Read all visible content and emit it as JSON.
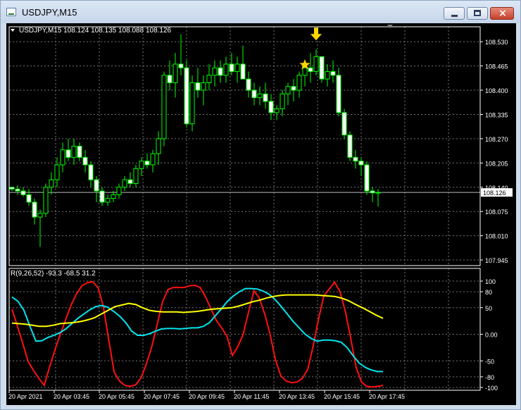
{
  "window": {
    "title": "USDJPY,M15",
    "icon": "chart-window-icon",
    "buttons": {
      "minimize": "minimize-icon",
      "maximize": "maximize-icon",
      "close": "×"
    }
  },
  "main_chart": {
    "header": "USDJPY,M15  108.124 108.135 108.088 108.126",
    "current_price": "108.126",
    "markers": [
      {
        "type": "star",
        "color": "#ffd700",
        "x_index": 52,
        "price": 108.468
      },
      {
        "type": "down-arrow",
        "color": "#ffd700",
        "x_index": 54,
        "price": 108.545
      }
    ]
  },
  "indicator": {
    "header": "R(9,26,52) -93.3 -68.5 31.2",
    "levels": [
      "100",
      "80",
      "50",
      "0.00",
      "-50",
      "-80",
      "-100"
    ]
  },
  "chart_data": [
    {
      "type": "candlestick",
      "symbol": "USDJPY",
      "timeframe": "M15",
      "ylim": [
        107.93,
        108.57
      ],
      "y_ticks": [
        "108.530",
        "108.465",
        "108.400",
        "108.335",
        "108.270",
        "108.205",
        "108.140",
        "108.075",
        "108.010",
        "107.945"
      ],
      "x_labels": [
        "20 Apr 2021",
        "20 Apr 03:45",
        "20 Apr 05:45",
        "20 Apr 07:45",
        "20 Apr 09:45",
        "20 Apr 11:45",
        "20 Apr 13:45",
        "20 Apr 15:45",
        "20 Apr 17:45"
      ],
      "grid": true,
      "candles": [
        [
          108.14,
          108.14,
          108.13,
          108.135
        ],
        [
          108.135,
          108.145,
          108.12,
          108.13
        ],
        [
          108.13,
          108.14,
          108.115,
          108.12
        ],
        [
          108.12,
          108.135,
          108.09,
          108.1
        ],
        [
          108.1,
          108.11,
          108.04,
          108.06
        ],
        [
          108.06,
          108.08,
          107.98,
          108.07
        ],
        [
          108.07,
          108.15,
          108.06,
          108.14
        ],
        [
          108.14,
          108.18,
          108.12,
          108.16
        ],
        [
          108.16,
          108.22,
          108.14,
          108.2
        ],
        [
          108.2,
          108.26,
          108.18,
          108.24
        ],
        [
          108.24,
          108.27,
          108.21,
          108.22
        ],
        [
          108.22,
          108.27,
          108.2,
          108.25
        ],
        [
          108.25,
          108.26,
          108.21,
          108.22
        ],
        [
          108.22,
          108.24,
          108.18,
          108.2
        ],
        [
          108.2,
          108.21,
          108.14,
          108.16
        ],
        [
          108.16,
          108.17,
          108.1,
          108.13
        ],
        [
          108.13,
          108.14,
          108.09,
          108.1
        ],
        [
          108.1,
          108.12,
          108.09,
          108.11
        ],
        [
          108.11,
          108.13,
          108.1,
          108.12
        ],
        [
          108.12,
          108.15,
          108.11,
          108.14
        ],
        [
          108.14,
          108.17,
          108.13,
          108.16
        ],
        [
          108.16,
          108.18,
          108.14,
          108.15
        ],
        [
          108.15,
          108.2,
          108.14,
          108.19
        ],
        [
          108.19,
          108.22,
          108.17,
          108.21
        ],
        [
          108.21,
          108.23,
          108.19,
          108.2
        ],
        [
          108.2,
          108.24,
          108.18,
          108.23
        ],
        [
          108.23,
          108.29,
          108.2,
          108.27
        ],
        [
          108.27,
          108.45,
          108.25,
          108.44
        ],
        [
          108.44,
          108.48,
          108.4,
          108.42
        ],
        [
          108.42,
          108.5,
          108.38,
          108.47
        ],
        [
          108.47,
          108.55,
          108.44,
          108.46
        ],
        [
          108.46,
          108.48,
          108.3,
          108.31
        ],
        [
          108.31,
          108.44,
          108.29,
          108.42
        ],
        [
          108.42,
          108.46,
          108.38,
          108.4
        ],
        [
          108.4,
          108.44,
          108.36,
          108.42
        ],
        [
          108.42,
          108.47,
          108.4,
          108.44
        ],
        [
          108.44,
          108.48,
          108.41,
          108.46
        ],
        [
          108.46,
          108.48,
          108.42,
          108.44
        ],
        [
          108.44,
          108.49,
          108.42,
          108.47
        ],
        [
          108.47,
          108.5,
          108.44,
          108.45
        ],
        [
          108.45,
          108.49,
          108.42,
          108.47
        ],
        [
          108.47,
          108.52,
          108.44,
          108.43
        ],
        [
          108.43,
          108.45,
          108.38,
          108.4
        ],
        [
          108.4,
          108.42,
          108.36,
          108.38
        ],
        [
          108.38,
          108.41,
          108.36,
          108.39
        ],
        [
          108.39,
          108.42,
          108.35,
          108.37
        ],
        [
          108.37,
          108.39,
          108.32,
          108.34
        ],
        [
          108.34,
          108.36,
          108.32,
          108.35
        ],
        [
          108.35,
          108.4,
          108.33,
          108.39
        ],
        [
          108.39,
          108.42,
          108.36,
          108.41
        ],
        [
          108.41,
          108.43,
          108.37,
          108.4
        ],
        [
          108.4,
          108.45,
          108.38,
          108.44
        ],
        [
          108.44,
          108.47,
          108.41,
          108.46
        ],
        [
          108.46,
          108.5,
          108.42,
          108.45
        ],
        [
          108.45,
          108.51,
          108.44,
          108.49
        ],
        [
          108.49,
          108.49,
          108.42,
          108.43
        ],
        [
          108.43,
          108.47,
          108.41,
          108.45
        ],
        [
          108.45,
          108.48,
          108.42,
          108.44
        ],
        [
          108.44,
          108.46,
          108.33,
          108.34
        ],
        [
          108.34,
          108.35,
          108.27,
          108.28
        ],
        [
          108.28,
          108.29,
          108.21,
          108.22
        ],
        [
          108.22,
          108.24,
          108.19,
          108.21
        ],
        [
          108.21,
          108.22,
          108.17,
          108.2
        ],
        [
          108.2,
          108.21,
          108.12,
          108.13
        ],
        [
          108.13,
          108.14,
          108.1,
          108.125
        ],
        [
          108.125,
          108.135,
          108.088,
          108.126
        ]
      ]
    },
    {
      "type": "line",
      "title": "R(9,26,52)",
      "ylim": [
        -100,
        100
      ],
      "y_ticks": [
        100,
        80,
        50,
        0,
        -50,
        -80,
        -100
      ],
      "series": [
        {
          "name": "R(9)",
          "color": "#ff1010",
          "values": [
            47,
            16,
            -17,
            -51,
            -68,
            -83,
            -96,
            -61,
            -29,
            0,
            28,
            55,
            76,
            91,
            97,
            99,
            88,
            52,
            -11,
            -71,
            -88,
            -96,
            -98,
            -95,
            -82,
            -56,
            -23,
            18,
            61,
            84,
            88,
            88,
            88,
            91,
            92,
            88,
            70,
            48,
            26,
            12,
            -4,
            -40,
            -23,
            0,
            42,
            82,
            68,
            38,
            0,
            -48,
            -78,
            -88,
            -91,
            -90,
            -83,
            -66,
            -23,
            28,
            72,
            85,
            98,
            80,
            43,
            -8,
            -62,
            -90,
            -98,
            -99,
            -98,
            -96
          ]
        },
        {
          "name": "R(26)",
          "color": "#00e5ee",
          "values": [
            70,
            62,
            45,
            15,
            -13,
            -12,
            -6,
            -2,
            3,
            10,
            20,
            30,
            38,
            46,
            52,
            54,
            51,
            43,
            34,
            22,
            6,
            -2,
            -2,
            1,
            6,
            10,
            11,
            11,
            10,
            11,
            12,
            12,
            15,
            22,
            35,
            48,
            62,
            72,
            80,
            86,
            86,
            85,
            81,
            75,
            65,
            52,
            38,
            24,
            12,
            0,
            -8,
            -13,
            -11,
            -11,
            -12,
            -15,
            -25,
            -40,
            -54,
            -62,
            -67,
            -70,
            -70
          ]
        },
        {
          "name": "R(52)",
          "color": "#ffff00",
          "values": [
            21,
            20,
            19,
            17,
            15,
            15,
            17,
            20,
            21,
            22,
            24,
            27,
            31,
            38,
            45,
            52,
            55,
            58,
            56,
            50,
            45,
            43,
            42,
            42,
            42,
            41,
            42,
            43,
            45,
            47,
            48,
            49,
            50,
            53,
            57,
            61,
            64,
            68,
            71,
            73,
            74,
            74,
            74,
            74,
            74,
            73,
            72,
            71,
            68,
            63,
            56,
            50,
            43,
            36,
            30
          ]
        }
      ]
    }
  ]
}
